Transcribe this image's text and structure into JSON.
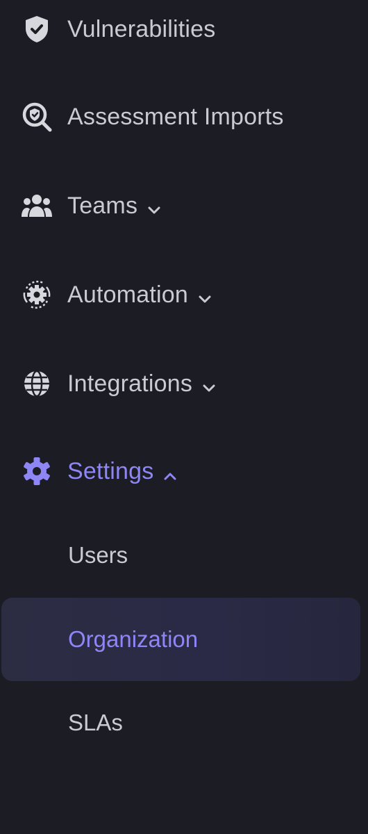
{
  "nav": {
    "items": [
      {
        "label": "Vulnerabilities",
        "icon": "shield-check-icon"
      },
      {
        "label": "Assessment Imports",
        "icon": "magnify-shield-icon"
      },
      {
        "label": "Teams",
        "icon": "users-icon",
        "chevron": "down"
      },
      {
        "label": "Automation",
        "icon": "cog-cycle-icon",
        "chevron": "down"
      },
      {
        "label": "Integrations",
        "icon": "globe-icon",
        "chevron": "down"
      },
      {
        "label": "Settings",
        "icon": "gear-icon",
        "chevron": "up",
        "active": true
      }
    ],
    "settings_children": [
      {
        "label": "Users"
      },
      {
        "label": "Organization",
        "selected": true
      },
      {
        "label": "SLAs"
      }
    ]
  },
  "colors": {
    "background": "#1b1c24",
    "text": "#c9cbd3",
    "accent": "#8f86f6",
    "selected_bg": "#2b2b44"
  }
}
